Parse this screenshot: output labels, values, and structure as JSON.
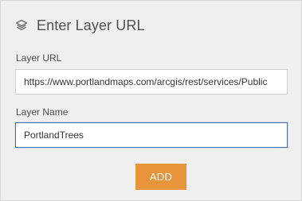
{
  "header": {
    "icon": "layers-icon",
    "title": "Enter Layer URL"
  },
  "form": {
    "url_label": "Layer URL",
    "url_value": "https://www.portlandmaps.com/arcgis/rest/services/Public",
    "name_label": "Layer Name",
    "name_value": "PortlandTrees",
    "add_label": "ADD"
  },
  "colors": {
    "button": "#e8943a",
    "panel": "#efefef",
    "focus_border": "#4c6fa0"
  }
}
